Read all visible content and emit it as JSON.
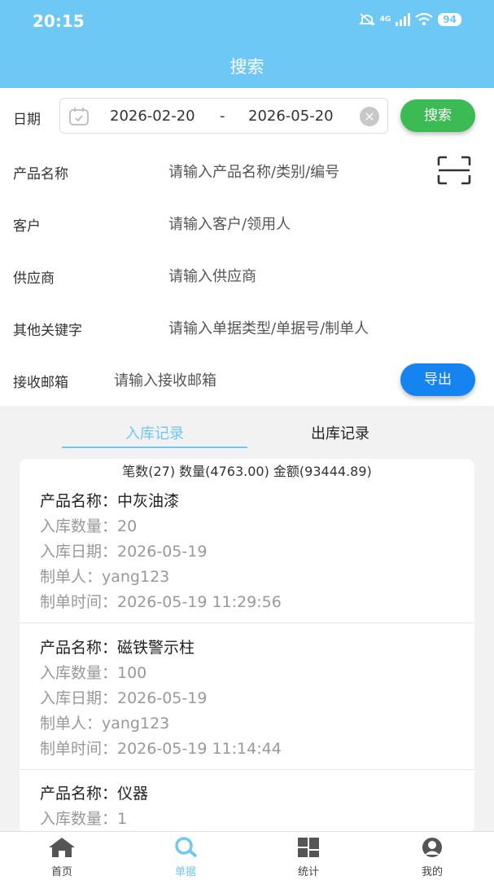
{
  "status": {
    "time": "20:15",
    "network": "4G",
    "battery": "94"
  },
  "header": {
    "title": "搜索"
  },
  "form": {
    "date_label": "日期",
    "date_start": "2026-02-20",
    "date_sep": "-",
    "date_end": "2026-05-20",
    "search_button": "搜索",
    "product_label": "产品名称",
    "product_placeholder": "请输入产品名称/类别/编号",
    "customer_label": "客户",
    "customer_placeholder": "请输入客户/领用人",
    "supplier_label": "供应商",
    "supplier_placeholder": "请输入供应商",
    "keyword_label": "其他关键字",
    "keyword_placeholder": "请输入单据类型/单据号/制单人",
    "email_label": "接收邮箱",
    "email_placeholder": "请输入接收邮箱",
    "export_button": "导出"
  },
  "tabs": {
    "in": "入库记录",
    "out": "出库记录"
  },
  "summary": "笔数(27) 数量(4763.00) 金额(93444.89)",
  "records": [
    {
      "name": "产品名称：中灰油漆",
      "qty": "入库数量：20",
      "date": "入库日期：2026-05-19",
      "maker": "制单人：yang123",
      "time": "制单时间：2026-05-19 11:29:56"
    },
    {
      "name": "产品名称：磁铁警示柱",
      "qty": "入库数量：100",
      "date": "入库日期：2026-05-19",
      "maker": "制单人：yang123",
      "time": "制单时间：2026-05-19 11:14:44"
    },
    {
      "name": "产品名称：仪器",
      "qty": "入库数量：1"
    }
  ],
  "nav": {
    "home": "首页",
    "docs": "单据",
    "stats": "统计",
    "mine": "我的"
  },
  "colors": {
    "accent": "#6ec8f5",
    "search": "#3cba54",
    "export": "#1583f0"
  }
}
